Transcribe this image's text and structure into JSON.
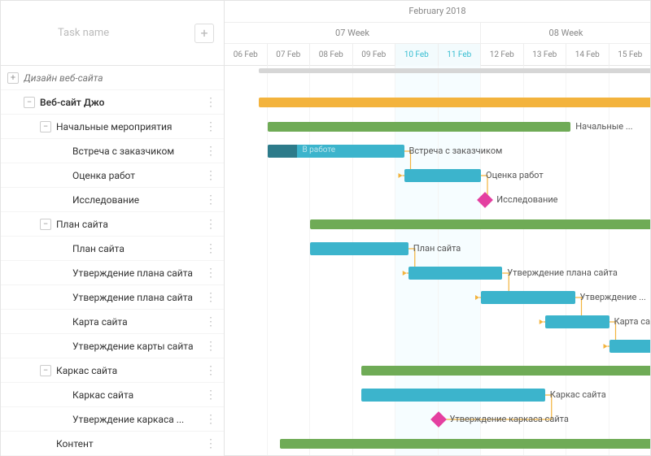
{
  "header": {
    "task_name_placeholder": "Task name",
    "month": "February 2018",
    "weeks": [
      "07 Week",
      "08 Week"
    ],
    "days": [
      "06 Feb",
      "07 Feb",
      "08 Feb",
      "09 Feb",
      "10 Feb",
      "11 Feb",
      "12 Feb",
      "13 Feb",
      "14 Feb",
      "15 Feb"
    ]
  },
  "tasks": [
    {
      "id": "root",
      "label": "Дизайн веб-сайта",
      "indent": 0,
      "toggle": "+",
      "style": "italic",
      "type": "baseline",
      "start": 0.8,
      "end": 10,
      "bars": [
        {
          "kind": "baseline",
          "start": 0.8,
          "end": 10
        }
      ]
    },
    {
      "id": "proj",
      "label": "Веб-сайт Джо",
      "indent": 1,
      "toggle": "-",
      "style": "bold",
      "type": "project",
      "start": 0.8,
      "end": 10,
      "bars": [
        {
          "kind": "project",
          "start": 0.8,
          "end": 10
        }
      ]
    },
    {
      "id": "init",
      "label": "Начальные мероприятия",
      "indent": 2,
      "toggle": "-",
      "type": "group",
      "start": 1,
      "end": 8.1,
      "bar_label": "Начальные ...",
      "bars": [
        {
          "kind": "group",
          "start": 1,
          "end": 8.1
        }
      ]
    },
    {
      "id": "meet",
      "label": "Встреча с заказчиком",
      "indent": 3,
      "type": "task",
      "start": 1,
      "end": 4.2,
      "progress": 0.22,
      "inbar": "В работе",
      "bar_label": "Встреча с заказчиком",
      "bars": [
        {
          "kind": "task",
          "start": 1,
          "end": 4.2,
          "progress": 0.22
        }
      ]
    },
    {
      "id": "est",
      "label": "Оценка работ",
      "indent": 3,
      "type": "task",
      "start": 4.2,
      "end": 6,
      "bar_label": "Оценка работ",
      "bars": [
        {
          "kind": "task",
          "start": 4.2,
          "end": 6
        }
      ]
    },
    {
      "id": "res",
      "label": "Исследование",
      "indent": 3,
      "type": "milestone",
      "at": 6.1,
      "bar_label": "Исследование",
      "bars": [
        {
          "kind": "milestone",
          "at": 6.1
        }
      ]
    },
    {
      "id": "plan-g",
      "label": "План сайта",
      "indent": 2,
      "toggle": "-",
      "type": "group",
      "start": 2,
      "end": 10,
      "bars": [
        {
          "kind": "group",
          "start": 2,
          "end": 10
        }
      ]
    },
    {
      "id": "plan",
      "label": "План сайта",
      "indent": 3,
      "type": "task",
      "start": 2,
      "end": 4.3,
      "bar_label": "План сайта",
      "bars": [
        {
          "kind": "task",
          "start": 2,
          "end": 4.3
        }
      ]
    },
    {
      "id": "appr1",
      "label": "Утверждение плана сайта",
      "indent": 3,
      "type": "task",
      "start": 4.3,
      "end": 6.5,
      "bar_label": "Утверждение плана сайта",
      "bars": [
        {
          "kind": "task",
          "start": 4.3,
          "end": 6.5
        }
      ]
    },
    {
      "id": "appr2",
      "label": "Утверждение плана сайта",
      "indent": 3,
      "type": "task",
      "start": 6,
      "end": 8.2,
      "bar_label": "Утверждение ...",
      "bars": [
        {
          "kind": "task",
          "start": 6,
          "end": 8.2
        }
      ]
    },
    {
      "id": "map",
      "label": "Карта сайта",
      "indent": 3,
      "type": "task",
      "start": 7.5,
      "end": 9,
      "bar_label": "Карта сайта",
      "bars": [
        {
          "kind": "task",
          "start": 7.5,
          "end": 9
        }
      ]
    },
    {
      "id": "appr-map",
      "label": "Утверждение карты сайта",
      "indent": 3,
      "type": "task",
      "start": 9,
      "end": 10,
      "bars": [
        {
          "kind": "task",
          "start": 9,
          "end": 10
        }
      ]
    },
    {
      "id": "wire-g",
      "label": "Каркас сайта",
      "indent": 2,
      "toggle": "-",
      "type": "group",
      "start": 3.2,
      "end": 10,
      "bars": [
        {
          "kind": "group",
          "start": 3.2,
          "end": 10
        }
      ]
    },
    {
      "id": "wire",
      "label": "Каркас сайта",
      "indent": 3,
      "type": "task",
      "start": 3.2,
      "end": 7.5,
      "bar_label": "Каркас сайта",
      "bars": [
        {
          "kind": "task",
          "start": 3.2,
          "end": 7.5
        }
      ]
    },
    {
      "id": "appr-wire",
      "label": "Утверждение каркаса ...",
      "indent": 3,
      "type": "milestone",
      "at": 5,
      "bar_label": "Утверждение каркаса сайта",
      "bars": [
        {
          "kind": "milestone",
          "at": 5
        }
      ]
    },
    {
      "id": "content",
      "label": "Контент",
      "indent": 2,
      "type": "group",
      "start": 1.3,
      "end": 10,
      "bars": [
        {
          "kind": "group",
          "start": 1.3,
          "end": 10
        }
      ]
    }
  ],
  "links": [
    {
      "from": "meet",
      "to": "est"
    },
    {
      "from": "est",
      "to": "res"
    },
    {
      "from": "plan",
      "to": "appr1"
    },
    {
      "from": "appr1",
      "to": "appr2"
    },
    {
      "from": "appr2",
      "to": "map"
    },
    {
      "from": "map",
      "to": "appr-map"
    },
    {
      "from": "wire",
      "to": "appr-wire"
    }
  ],
  "chart_data": {
    "type": "gantt",
    "title": "Дизайн веб-сайта",
    "time_axis": {
      "unit": "day",
      "start": "2018-02-06",
      "end": "2018-02-15",
      "month": "February 2018",
      "weeks": [
        "07 Week",
        "08 Week"
      ],
      "weekend_days": [
        "2018-02-10",
        "2018-02-11"
      ]
    },
    "series": [
      {
        "name": "Дизайн веб-сайта",
        "type": "summary",
        "level": 0,
        "start": "2018-02-06",
        "end": "2018-02-15"
      },
      {
        "name": "Веб-сайт Джо",
        "type": "project",
        "level": 1,
        "start": "2018-02-06",
        "end": "2018-02-15"
      },
      {
        "name": "Начальные мероприятия",
        "type": "group",
        "level": 2,
        "start": "2018-02-07",
        "end": "2018-02-14"
      },
      {
        "name": "Встреча с заказчиком",
        "type": "task",
        "level": 3,
        "start": "2018-02-07",
        "end": "2018-02-10",
        "progress": 22,
        "status": "В работе"
      },
      {
        "name": "Оценка работ",
        "type": "task",
        "level": 3,
        "start": "2018-02-10",
        "end": "2018-02-12"
      },
      {
        "name": "Исследование",
        "type": "milestone",
        "level": 3,
        "date": "2018-02-12"
      },
      {
        "name": "План сайта",
        "type": "group",
        "level": 2,
        "start": "2018-02-08",
        "end": "2018-02-15"
      },
      {
        "name": "План сайта",
        "type": "task",
        "level": 3,
        "start": "2018-02-08",
        "end": "2018-02-10"
      },
      {
        "name": "Утверждение плана сайта",
        "type": "task",
        "level": 3,
        "start": "2018-02-10",
        "end": "2018-02-12"
      },
      {
        "name": "Утверждение плана сайта",
        "type": "task",
        "level": 3,
        "start": "2018-02-12",
        "end": "2018-02-14"
      },
      {
        "name": "Карта сайта",
        "type": "task",
        "level": 3,
        "start": "2018-02-13",
        "end": "2018-02-15"
      },
      {
        "name": "Утверждение карты сайта",
        "type": "task",
        "level": 3,
        "start": "2018-02-15",
        "end": "2018-02-15"
      },
      {
        "name": "Каркас сайта",
        "type": "group",
        "level": 2,
        "start": "2018-02-09",
        "end": "2018-02-15"
      },
      {
        "name": "Каркас сайта",
        "type": "task",
        "level": 3,
        "start": "2018-02-09",
        "end": "2018-02-13"
      },
      {
        "name": "Утверждение каркаса сайта",
        "type": "milestone",
        "level": 3,
        "date": "2018-02-11"
      },
      {
        "name": "Контент",
        "type": "group",
        "level": 2,
        "start": "2018-02-07",
        "end": "2018-02-15"
      }
    ],
    "dependencies": [
      [
        "Встреча с заказчиком",
        "Оценка работ"
      ],
      [
        "Оценка работ",
        "Исследование"
      ],
      [
        "План сайта",
        "Утверждение плана сайта"
      ],
      [
        "Утверждение плана сайта",
        "Утверждение плана сайта"
      ],
      [
        "Утверждение плана сайта",
        "Карта сайта"
      ],
      [
        "Карта сайта",
        "Утверждение карты сайта"
      ],
      [
        "Каркас сайта",
        "Утверждение каркаса сайта"
      ]
    ]
  },
  "colors": {
    "task": "#3cb4cc",
    "progress": "#2d7b8a",
    "group": "#6fab56",
    "project": "#f3b33d",
    "milestone": "#e43fa0",
    "link": "#f3b33d"
  }
}
